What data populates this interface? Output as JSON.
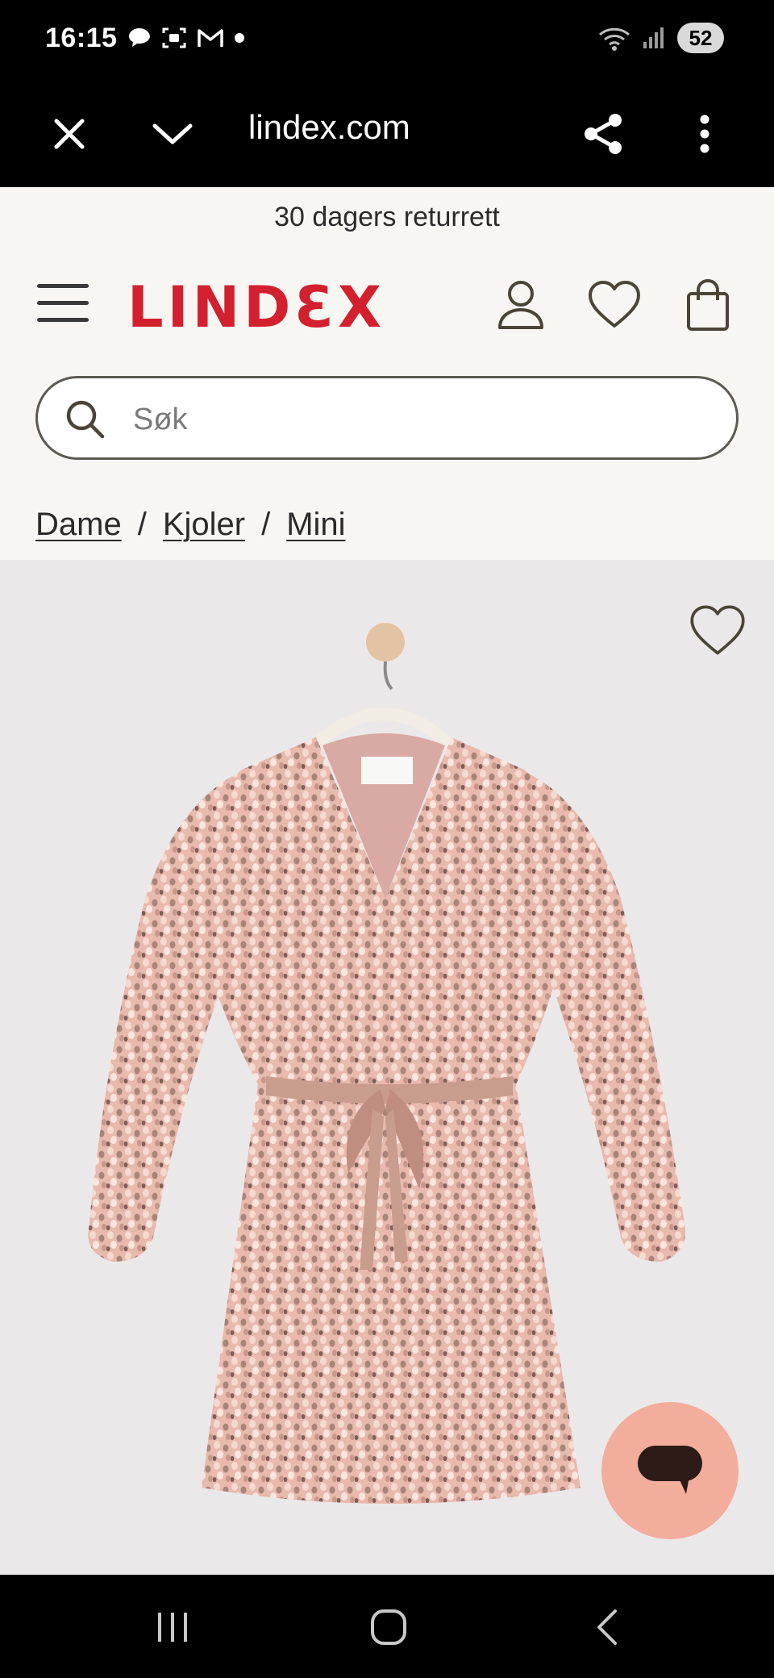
{
  "status_bar": {
    "time": "16:15",
    "battery": "52",
    "icons_left": [
      "chat-bubble-icon",
      "screenshot-icon",
      "gmail-icon",
      "dot-icon"
    ],
    "icons_right": [
      "wifi-icon",
      "signal-icon"
    ]
  },
  "browser": {
    "url": "lindex.com",
    "icons": [
      "close-icon",
      "chevron-down-icon",
      "share-icon",
      "more-vertical-icon"
    ]
  },
  "site": {
    "promo": "30 dagers returrett",
    "logo": "LINDƐX",
    "brand_color": "#d2202f",
    "header_icons": [
      "menu-icon",
      "user-icon",
      "heart-icon",
      "bag-icon"
    ],
    "search": {
      "placeholder": "Søk"
    },
    "breadcrumb": [
      {
        "label": "Dame"
      },
      {
        "label": "Kjoler"
      },
      {
        "label": "Mini"
      }
    ],
    "breadcrumb_separator": "/"
  },
  "product": {
    "image": "pink-sequin-wrap-dress-on-hanger",
    "background": "#ebe8ea",
    "chat_button_color": "#f2ad9c"
  },
  "nav_bar": {
    "icons": [
      "recent-apps-icon",
      "home-icon",
      "back-icon"
    ]
  }
}
